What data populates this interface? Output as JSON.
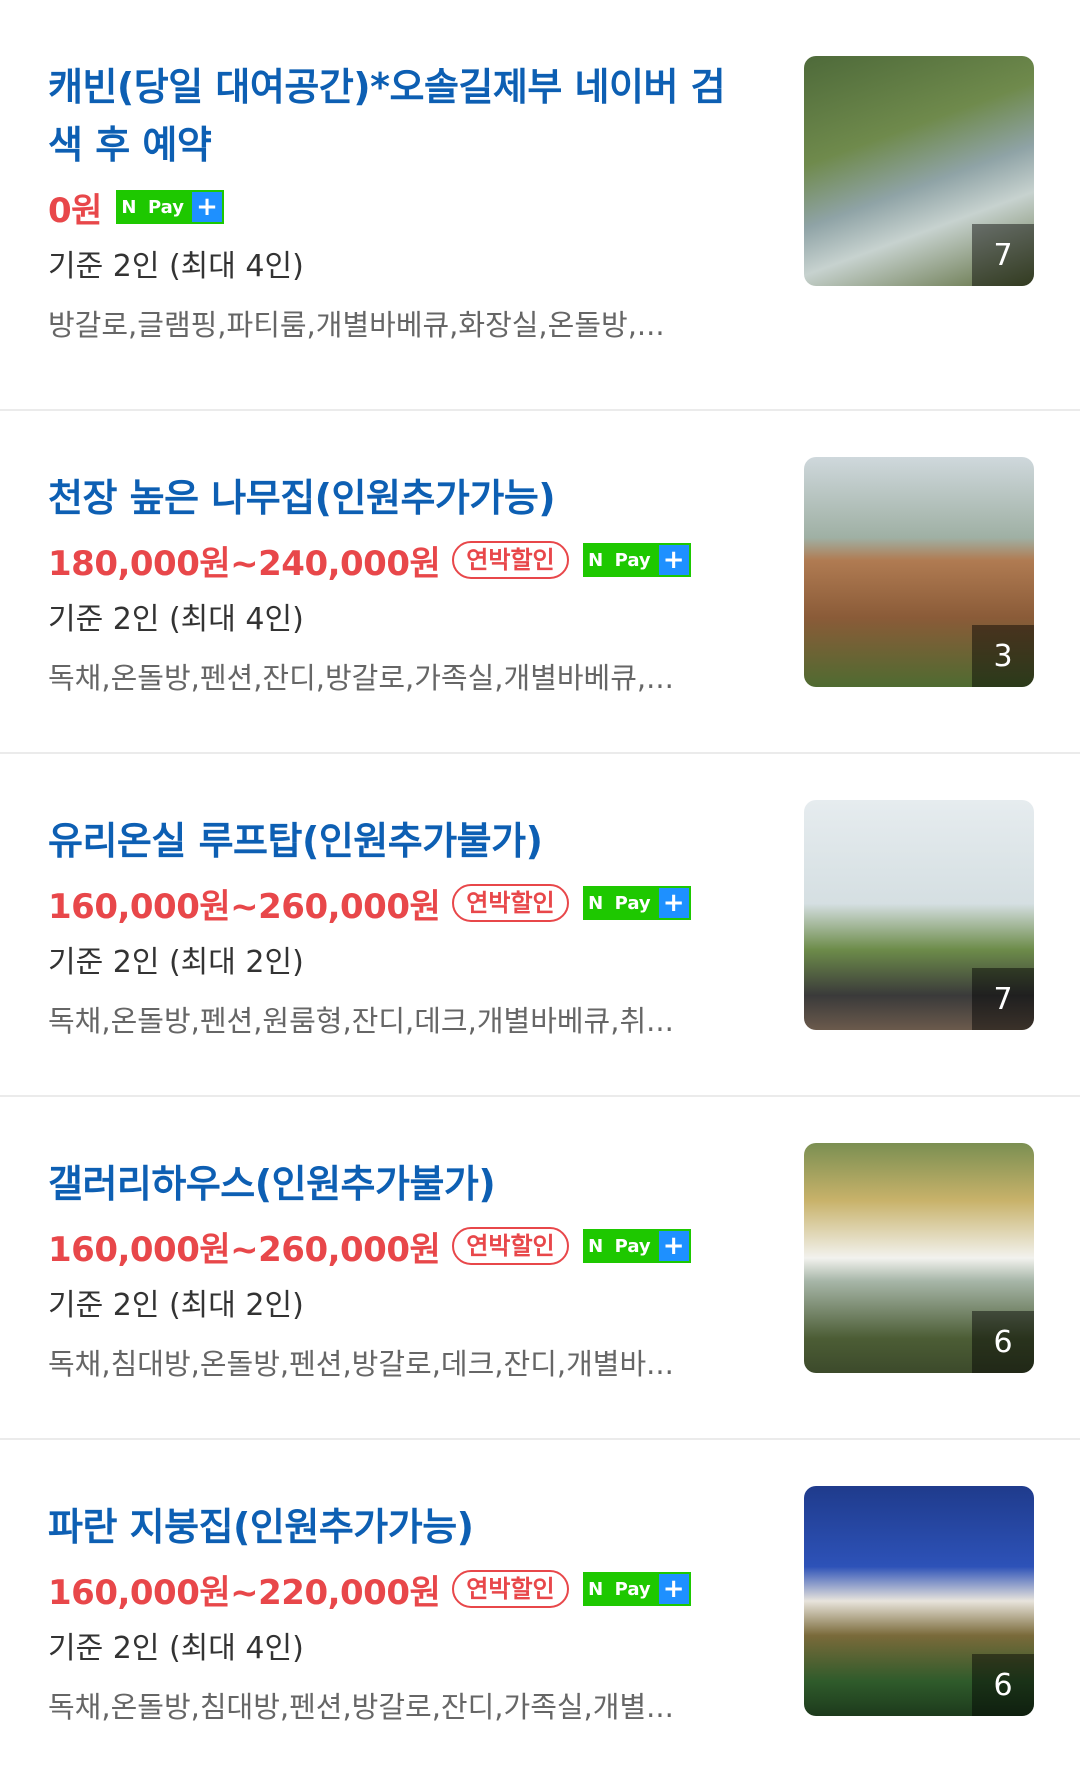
{
  "listings": [
    {
      "title": "캐빈(당일 대여공간)*오솔길제부 네이버 검색 후 예약",
      "price": "0원",
      "sale_badge": "",
      "npay": {
        "n": "N",
        "pay": "Pay",
        "plus": "+"
      },
      "capacity": "기준 2인 (최대 4인)",
      "tags": "방갈로,글램핑,파티룸,개별바베큐,화장실,온돌방,...",
      "photo_count": "7"
    },
    {
      "title": "천장 높은 나무집(인원추가가능)",
      "price": "180,000원~240,000원",
      "sale_badge": "연박할인",
      "npay": {
        "n": "N",
        "pay": "Pay",
        "plus": "+"
      },
      "capacity": "기준 2인 (최대 4인)",
      "tags": "독채,온돌방,펜션,잔디,방갈로,가족실,개별바베큐,...",
      "photo_count": "3"
    },
    {
      "title": "유리온실 루프탑(인원추가불가)",
      "price": "160,000원~260,000원",
      "sale_badge": "연박할인",
      "npay": {
        "n": "N",
        "pay": "Pay",
        "plus": "+"
      },
      "capacity": "기준 2인 (최대 2인)",
      "tags": "독채,온돌방,펜션,원룸형,잔디,데크,개별바베큐,취...",
      "photo_count": "7"
    },
    {
      "title": "갤러리하우스(인원추가불가)",
      "price": "160,000원~260,000원",
      "sale_badge": "연박할인",
      "npay": {
        "n": "N",
        "pay": "Pay",
        "plus": "+"
      },
      "capacity": "기준 2인 (최대 2인)",
      "tags": "독채,침대방,온돌방,펜션,방갈로,데크,잔디,개별바...",
      "photo_count": "6"
    },
    {
      "title": "파란 지붕집(인원추가가능)",
      "price": "160,000원~220,000원",
      "sale_badge": "연박할인",
      "npay": {
        "n": "N",
        "pay": "Pay",
        "plus": "+"
      },
      "capacity": "기준 2인 (최대 4인)",
      "tags": "독채,온돌방,침대방,펜션,방갈로,잔디,가족실,개별...",
      "photo_count": "6"
    }
  ]
}
